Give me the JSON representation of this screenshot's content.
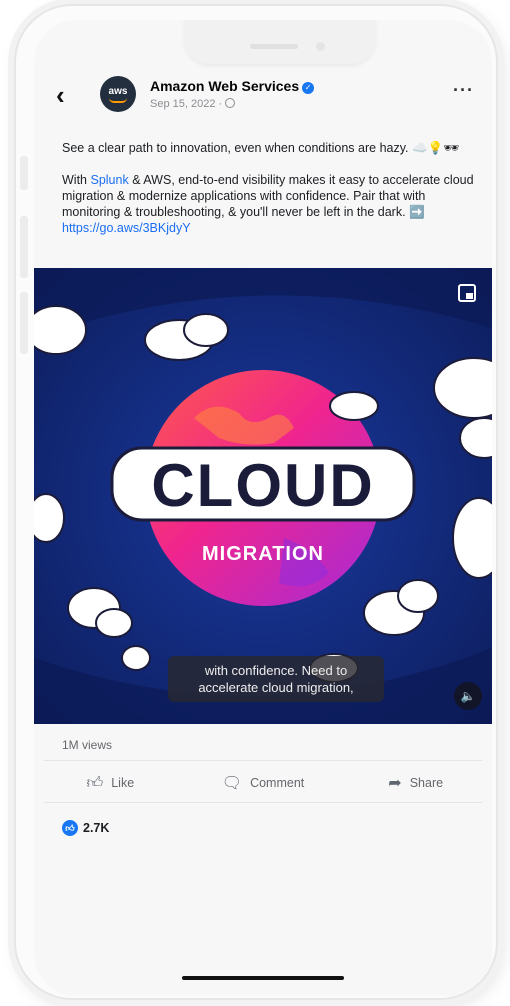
{
  "post": {
    "page_name": "Amazon Web Services",
    "avatar_label": "aws",
    "date": "Sep 15, 2022 ·",
    "paragraph1": "See a clear path to innovation, even when conditions are hazy. ☁️💡🕶",
    "p2_prefix": "With ",
    "p2_link": "Splunk",
    "p2_body": " & AWS, end-to-end visibility makes it easy to accelerate cloud migration & modernize applications with confidence. Pair that with monitoring & troubleshooting, & you'll never be left in the dark. ➡️ ",
    "url": "https://go.aws/3BKjdyY"
  },
  "video": {
    "title_word": "CLOUD",
    "subtitle": "MIGRATION",
    "caption_line1": "with confidence. Need to",
    "caption_line2": "accelerate cloud migration,"
  },
  "stats": {
    "views": "1M views",
    "reactions_count": "2.7K"
  },
  "actions": {
    "like": "Like",
    "comment": "Comment",
    "share": "Share"
  },
  "colors": {
    "accent": "#1877f2",
    "link": "#1b6ef3",
    "video_bg": "#142a78",
    "globe_pink": "#e6208f"
  },
  "icons": {
    "back": "chevron-left",
    "verified": "checkmark-badge",
    "more": "ellipsis",
    "like": "thumbs-up",
    "comment": "speech-bubble",
    "share": "share-arrow",
    "mute": "speaker",
    "pip": "picture-in-picture"
  }
}
